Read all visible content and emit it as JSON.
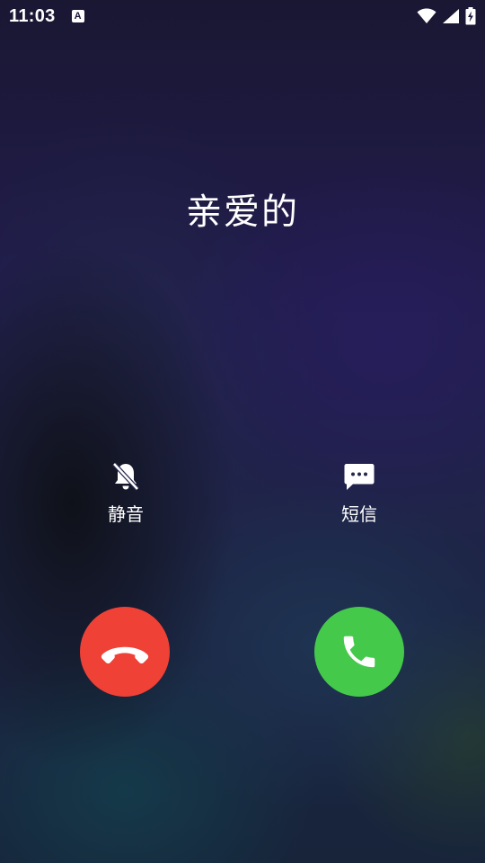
{
  "status_bar": {
    "time": "11:03",
    "notification_glyph": "A",
    "icons": [
      "wifi-icon",
      "cell-signal-icon",
      "battery-charging-icon"
    ]
  },
  "caller": {
    "name": "亲爱的"
  },
  "actions": {
    "mute": {
      "label": "静音",
      "icon": "bell-off-icon"
    },
    "sms": {
      "label": "短信",
      "icon": "message-icon"
    }
  },
  "call_buttons": {
    "decline": {
      "icon": "phone-hangup-icon",
      "color": "#ef4136"
    },
    "answer": {
      "icon": "phone-icon",
      "color": "#45c94a"
    }
  }
}
